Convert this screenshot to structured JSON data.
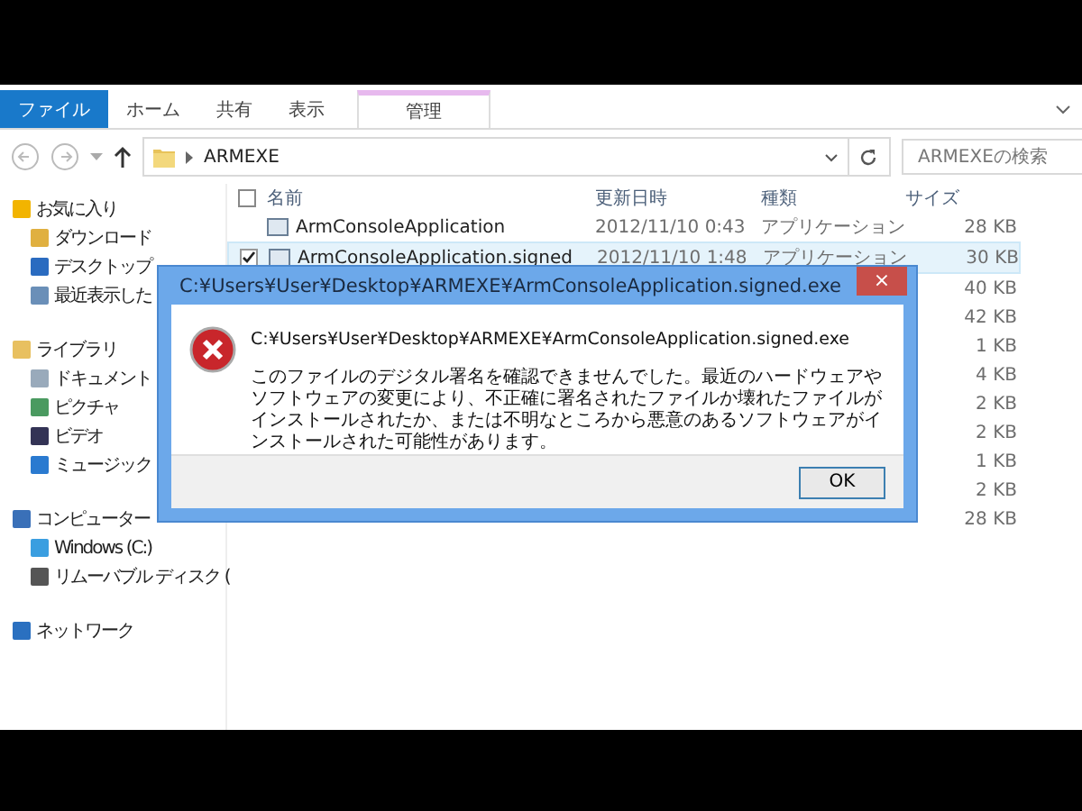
{
  "ribbon": {
    "tabs": [
      {
        "label": "ファイル",
        "selected": true,
        "kind": "file"
      },
      {
        "label": "ホーム",
        "selected": false,
        "kind": "tab"
      },
      {
        "label": "共有",
        "selected": false,
        "kind": "tab"
      },
      {
        "label": "表示",
        "selected": false,
        "kind": "tab"
      },
      {
        "label": "管理",
        "selected": false,
        "kind": "context"
      }
    ]
  },
  "address_bar": {
    "path": "ARMEXE",
    "search": {
      "placeholder": "ARMEXEの検索"
    }
  },
  "sidebar": {
    "groups": [
      {
        "label": "お気に入り",
        "items": [
          {
            "label": "ダウンロード"
          },
          {
            "label": "デスクトップ"
          },
          {
            "label": "最近表示した"
          }
        ]
      },
      {
        "label": "ライブラリ",
        "items": [
          {
            "label": "ドキュメント"
          },
          {
            "label": "ピクチャ"
          },
          {
            "label": "ビデオ"
          },
          {
            "label": "ミュージック"
          }
        ]
      },
      {
        "label": "コンピューター",
        "items": [
          {
            "label": "Windows (C:)"
          },
          {
            "label": "リムーバブル ディスク ("
          }
        ]
      },
      {
        "label": "ネットワーク"
      }
    ]
  },
  "table": {
    "select_all": {
      "checked": false
    },
    "columns": [
      "名前",
      "更新日時",
      "種類",
      "サイズ"
    ],
    "rows": [
      {
        "name": "ArmConsoleApplication",
        "date": "2012/11/10 0:43",
        "type": "アプリケーション",
        "size": "28 KB"
      },
      {
        "name": "ArmConsoleApplication.signed",
        "date": "2012/11/10 1:48",
        "type": "アプリケーション",
        "size": "30 KB",
        "checked": true
      },
      {
        "size": "40 KB"
      },
      {
        "size": "42 KB"
      },
      {
        "size": "1 KB"
      },
      {
        "size": "4 KB"
      },
      {
        "size": "2 KB"
      },
      {
        "size": "2 KB"
      },
      {
        "size": "1 KB"
      },
      {
        "size": "2 KB"
      },
      {
        "size": "28 KB"
      }
    ]
  },
  "dialog": {
    "title": "C:¥Users¥User¥Desktop¥ARMEXE¥ArmConsoleApplication.signed.exe",
    "close": "×",
    "path": "C:¥Users¥User¥Desktop¥ARMEXE¥ArmConsoleApplication.signed.exe",
    "message": "このファイルのデジタル署名を確認できませんでした。最近のハードウェアやソフトウェアの変更により、不正確に署名されたファイルか壊れたファイルがインストールされたか、または不明なところから悪意のあるソフトウェアがインストールされた可能性があります。",
    "button": "OK"
  }
}
